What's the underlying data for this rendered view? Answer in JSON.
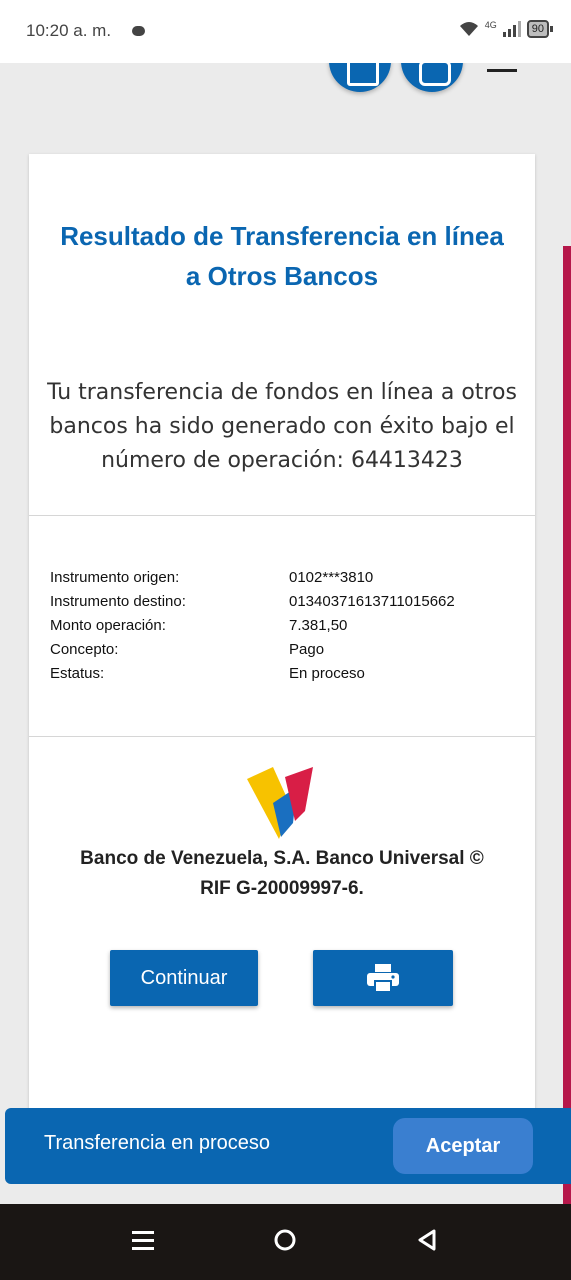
{
  "status_bar": {
    "time": "10:20 a. m.",
    "network": "4G",
    "battery": "90"
  },
  "result": {
    "title": "Resultado de Transferencia en línea a Otros Bancos",
    "message": "Tu transferencia de fondos en línea a otros bancos ha sido generado con éxito bajo el número de operación: 64413423"
  },
  "details": [
    {
      "label": "Instrumento origen:",
      "value": "0102***3810"
    },
    {
      "label": "Instrumento destino:",
      "value": "01340371613711015662"
    },
    {
      "label": "Monto operación:",
      "value": "7.381,50"
    },
    {
      "label": "Concepto:",
      "value": "Pago"
    },
    {
      "label": "Estatus:",
      "value": "En proceso"
    }
  ],
  "bank": {
    "name_line": "Banco de Venezuela, S.A. Banco Universal ©",
    "rif_line": "RIF G-20009997-6."
  },
  "buttons": {
    "continue_label": "Continuar",
    "print_icon": "printer-icon"
  },
  "snackbar": {
    "message": "Transferencia en proceso",
    "action_label": "Aceptar"
  },
  "colors": {
    "primary": "#0a66b1",
    "accent_bar": "#b5174a",
    "snackbar_button": "#3a7fd0",
    "logo_yellow": "#f7c200",
    "logo_blue": "#1a6fc0",
    "logo_red": "#d81e46"
  },
  "nav": {
    "recent_icon": "recent-apps-icon",
    "home_icon": "home-icon",
    "back_icon": "back-icon"
  }
}
